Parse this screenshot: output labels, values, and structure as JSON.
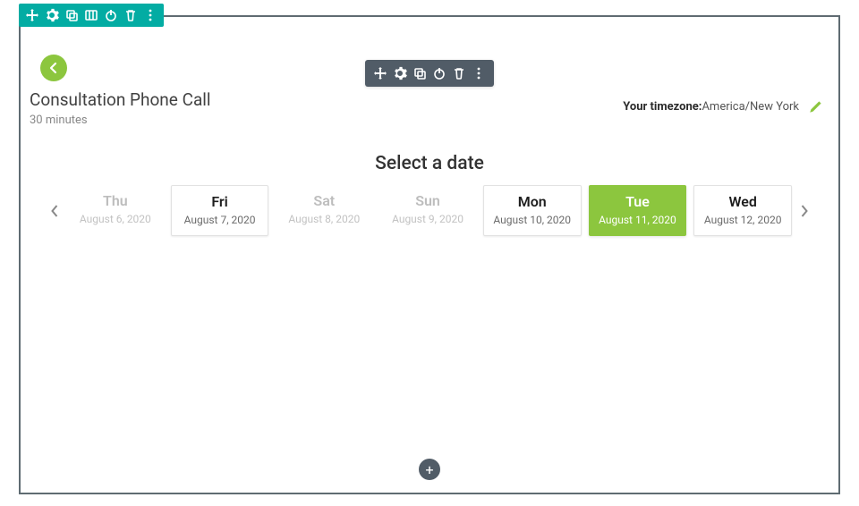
{
  "header": {
    "title": "Consultation Phone Call",
    "subtitle": "30 minutes"
  },
  "timezone": {
    "label": "Your timezone:",
    "value": "America/New York"
  },
  "date_picker": {
    "heading": "Select a date",
    "days": [
      {
        "dow": "Thu",
        "date": "August 6, 2020",
        "state": "disabled"
      },
      {
        "dow": "Fri",
        "date": "August 7, 2020",
        "state": "available"
      },
      {
        "dow": "Sat",
        "date": "August 8, 2020",
        "state": "disabled"
      },
      {
        "dow": "Sun",
        "date": "August 9, 2020",
        "state": "disabled"
      },
      {
        "dow": "Mon",
        "date": "August 10, 2020",
        "state": "available"
      },
      {
        "dow": "Tue",
        "date": "August 11, 2020",
        "state": "selected"
      },
      {
        "dow": "Wed",
        "date": "August 12, 2020",
        "state": "available"
      }
    ]
  },
  "outer_toolbar_icons": [
    "move-icon",
    "gear-icon",
    "duplicate-icon",
    "columns-icon",
    "power-icon",
    "trash-icon",
    "more-vertical-icon"
  ],
  "inner_toolbar_icons": [
    "move-icon",
    "gear-icon",
    "duplicate-icon",
    "power-icon",
    "trash-icon",
    "more-vertical-icon"
  ]
}
